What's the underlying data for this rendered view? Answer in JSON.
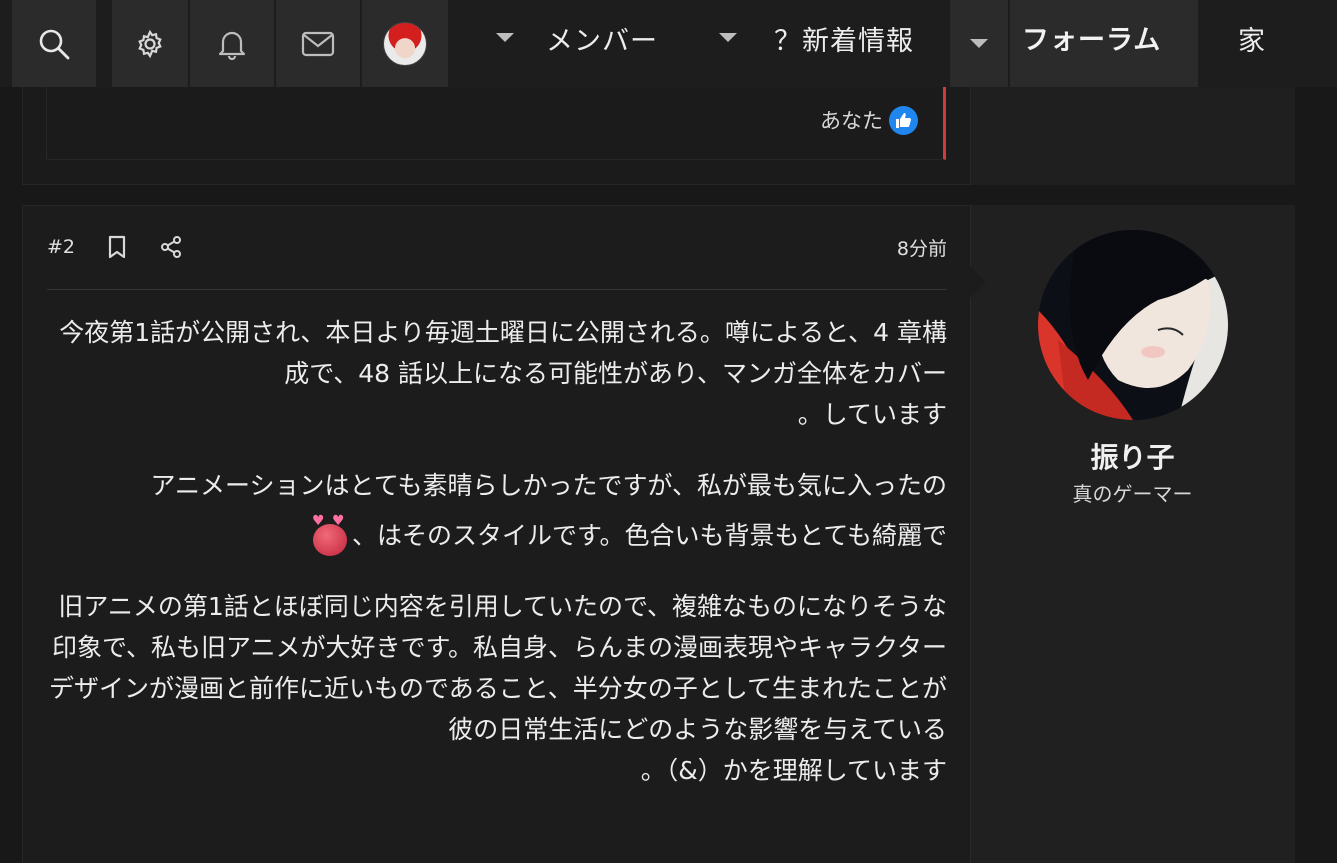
{
  "nav": {
    "icons": [
      "search-icon",
      "gear-icon",
      "bell-icon",
      "mail-icon",
      "avatar"
    ],
    "members_label": "メンバー",
    "whats_new_label": "？新着情報",
    "forum_label": "フォーラム",
    "home_label": "家"
  },
  "prev_post": {
    "reaction_user": "あなた",
    "reaction_icon": "thumbs-up-icon",
    "reaction_color": "#1f86f0",
    "accent_color": "#d23b3b"
  },
  "post": {
    "number": "#2",
    "time": "8分前",
    "paragraphs": [
      {
        "lines": [
          "今夜第1話が公開され、本日より毎週土曜日に公開される。噂によると、4 章構成で、48 話以上になる可能性があり、マンガ全体をカバー",
          "。しています"
        ]
      },
      {
        "line1": "アニメーションはとても素晴らしかったですが、私が最も気に入ったの",
        "line2": "、はそのスタイルです。色合いも背景もとても綺麗で",
        "emoji": "heart-eyes-emoji"
      },
      {
        "lines": [
          "旧アニメの第1話とほぼ同じ内容を引用していたので、複雑なものになりそうな印象で、私も旧アニメが大好きです。私自身、らんまの漫画表現やキャラクターデザインが漫画と前作に近いものであること、半分女の子として生まれたことが彼の日常生活にどのような影響を与えている",
          "。（&）かを理解しています"
        ]
      }
    ]
  },
  "user": {
    "name": "振り子",
    "title": "真のゲーマー"
  }
}
